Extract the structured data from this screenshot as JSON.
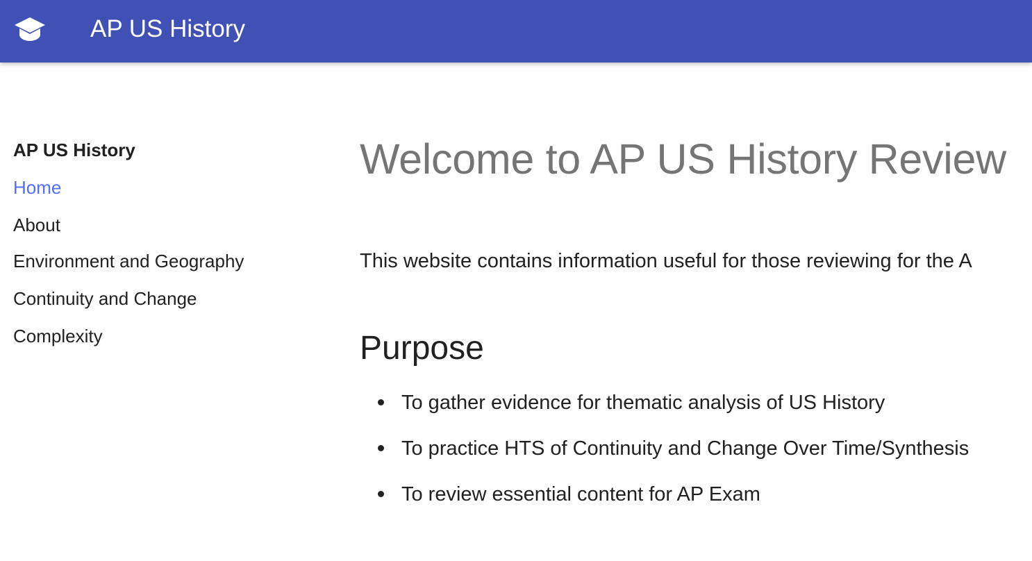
{
  "header": {
    "logo_icon": "graduation-cap-icon",
    "title": "AP US History",
    "background": "#3f51b5"
  },
  "sidebar": {
    "heading": "AP US History",
    "items": [
      {
        "label": "Home",
        "active": true
      },
      {
        "label": "About",
        "active": false
      },
      {
        "label": "Environment and Geography",
        "active": false
      },
      {
        "label": "Continuity and Change",
        "active": false
      },
      {
        "label": "Complexity",
        "active": false
      }
    ],
    "active_color": "#536dfe"
  },
  "main": {
    "title": "Welcome to AP US History Review",
    "intro": "This website contains information useful for those reviewing for the A",
    "purpose_heading": "Purpose",
    "purpose_items": [
      "To gather evidence for thematic analysis of US History",
      "To practice HTS of Continuity and Change Over Time/Synthesis",
      "To review essential content for AP Exam"
    ]
  }
}
